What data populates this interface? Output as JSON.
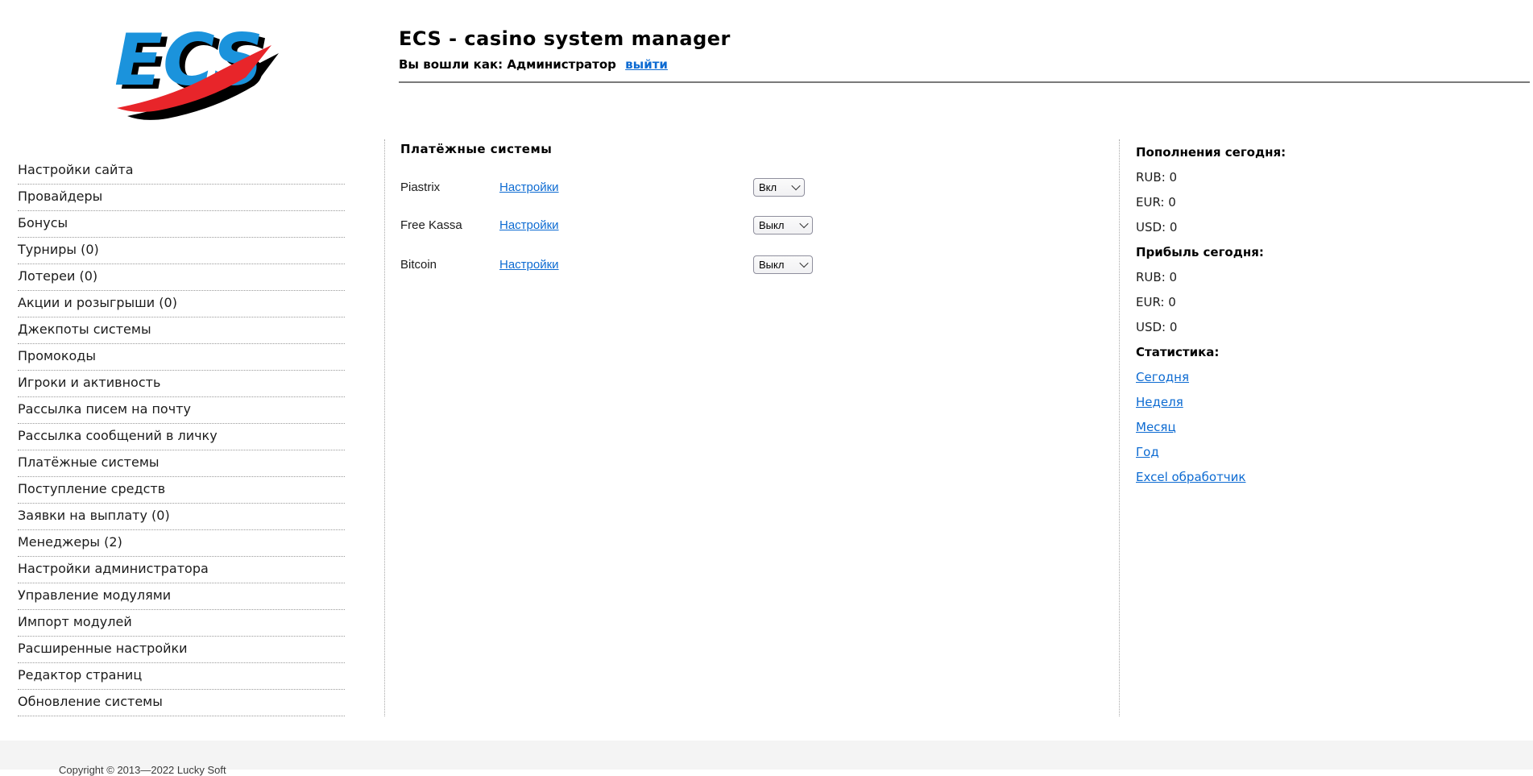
{
  "header": {
    "logo_text": "ECS",
    "title": "ECS - casino system manager",
    "login_prefix": "Вы вошли как: Администратор",
    "logout_label": "выйти"
  },
  "sidebar": {
    "items": [
      {
        "label": "Настройки сайта"
      },
      {
        "label": "Провайдеры"
      },
      {
        "label": "Бонусы"
      },
      {
        "label": "Турниры (0)"
      },
      {
        "label": "Лотереи (0)"
      },
      {
        "label": "Акции и розыгрыши (0)"
      },
      {
        "label": "Джекпоты системы"
      },
      {
        "label": "Промокоды"
      },
      {
        "label": "Игроки и активность"
      },
      {
        "label": "Рассылка писем на почту"
      },
      {
        "label": "Рассылка сообщений в личку"
      },
      {
        "label": "Платёжные системы"
      },
      {
        "label": "Поступление средств"
      },
      {
        "label": "Заявки на выплату (0)"
      },
      {
        "label": "Менеджеры (2)"
      },
      {
        "label": "Настройки администратора"
      },
      {
        "label": "Управление модулями"
      },
      {
        "label": "Импорт модулей"
      },
      {
        "label": "Расширенные настройки"
      },
      {
        "label": "Редактор страниц"
      },
      {
        "label": "Обновление системы"
      }
    ]
  },
  "main": {
    "heading": "Платёжные системы",
    "rows": [
      {
        "name": "Piastrix",
        "settings_label": "Настройки",
        "state": "Вкл"
      },
      {
        "name": "Free Kassa",
        "settings_label": "Настройки",
        "state": "Выкл"
      },
      {
        "name": "Bitcoin",
        "settings_label": "Настройки",
        "state": "Выкл"
      }
    ]
  },
  "right_panel": {
    "deposits_heading": "Пополнения сегодня:",
    "deposits": [
      {
        "label": "RUB: 0"
      },
      {
        "label": "EUR: 0"
      },
      {
        "label": "USD: 0"
      }
    ],
    "profit_heading": "Прибыль сегодня:",
    "profit": [
      {
        "label": "RUB: 0"
      },
      {
        "label": "EUR: 0"
      },
      {
        "label": "USD: 0"
      }
    ],
    "stats_heading": "Статистика:",
    "stats_links": [
      {
        "label": "Сегодня"
      },
      {
        "label": "Неделя"
      },
      {
        "label": "Месяц"
      },
      {
        "label": "Год"
      },
      {
        "label": "Excel обработчик"
      }
    ]
  },
  "footer": {
    "copyright": "Copyright © 2013—2022 Lucky Soft"
  },
  "colors": {
    "link_blue": "#0d6bd2",
    "logo_blue": "#1b93dc",
    "logo_red": "#e8252a",
    "rule_gray": "#7a7a7a",
    "footer_bg": "#f4f4f4"
  }
}
